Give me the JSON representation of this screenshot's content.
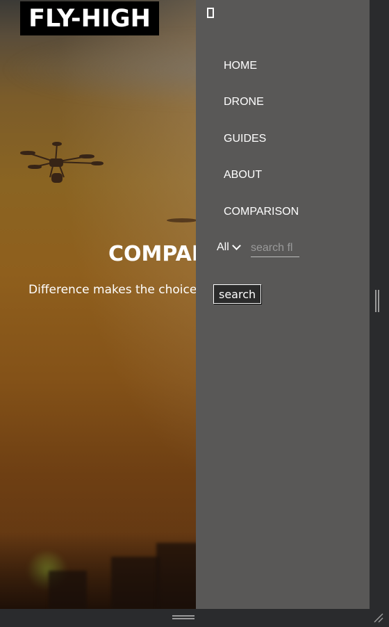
{
  "brand": {
    "logo_text": "FLY-HIGH"
  },
  "hero": {
    "title": "COMPARI",
    "subtitle": "Difference makes the choice"
  },
  "menu": {
    "close_icon": "close-icon",
    "items": [
      {
        "label": "HOME"
      },
      {
        "label": "DRONE"
      },
      {
        "label": "GUIDES"
      },
      {
        "label": "ABOUT"
      },
      {
        "label": "COMPARISON"
      }
    ],
    "filter": {
      "selected": "All"
    },
    "search": {
      "placeholder": "search fl",
      "value": ""
    },
    "search_button_label": "search"
  },
  "colors": {
    "menu_bg": "#595857",
    "frame_bg": "#2a2b2d",
    "logo_bg": "#000000"
  }
}
